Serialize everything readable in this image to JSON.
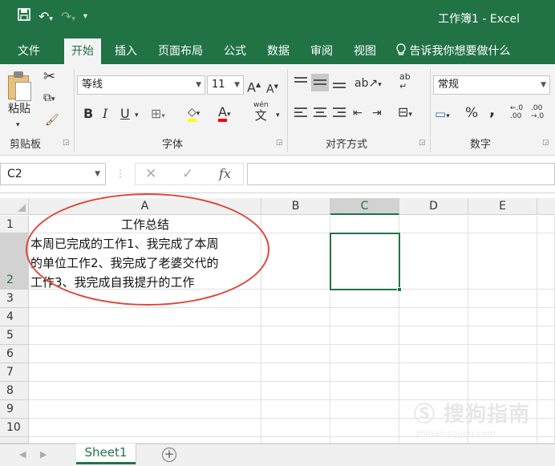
{
  "titlebar": {
    "title": "工作簿1 - Excel",
    "qat_icons": [
      "save-icon",
      "undo-icon",
      "redo-icon",
      "customize-icon"
    ]
  },
  "tabs": [
    {
      "label": "文件"
    },
    {
      "label": "开始",
      "active": true
    },
    {
      "label": "插入"
    },
    {
      "label": "页面布局"
    },
    {
      "label": "公式"
    },
    {
      "label": "数据"
    },
    {
      "label": "审阅"
    },
    {
      "label": "视图"
    }
  ],
  "tell_me": "告诉我你想要做什么",
  "ribbon": {
    "clipboard": {
      "paste_label": "粘贴",
      "group_label": "剪贴板"
    },
    "font": {
      "font_name": "等线",
      "font_size": "11",
      "increase_size": "A",
      "decrease_size": "A",
      "bold": "B",
      "italic": "I",
      "underline": "U",
      "font_color_glyph": "A",
      "pinyin_top": "wén",
      "pinyin_char": "文",
      "group_label": "字体"
    },
    "alignment": {
      "group_label": "对齐方式",
      "wrap_glyph": "ab"
    },
    "number": {
      "format": "常规",
      "percent": "%",
      "comma": ",",
      "increase_decimal": "←.0 .00",
      "decrease_decimal": ".00 →.0",
      "group_label": "数字"
    }
  },
  "formula_bar": {
    "name_box": "C2",
    "cancel_glyph": "✕",
    "enter_glyph": "✓",
    "fx": "fx",
    "value": ""
  },
  "grid": {
    "columns": [
      "A",
      "B",
      "C",
      "D",
      "E"
    ],
    "rows": [
      "1",
      "2",
      "3",
      "4",
      "5",
      "6",
      "7",
      "8",
      "9",
      "10"
    ],
    "cells": {
      "A1": "工作总结",
      "A2_lines": [
        "本周已完成的工作1、我完成了本周",
        "的单位工作2、我完成了老婆交代的",
        "工作3、我完成自我提升的工作"
      ]
    },
    "selected_cell": "C2"
  },
  "sheets": [
    {
      "name": "Sheet1",
      "active": true
    }
  ],
  "watermark": {
    "text": "搜狗指南",
    "subtext": "zhinan.sogou.com"
  },
  "colors": {
    "accent": "#217346",
    "annotation": "#e0453a"
  }
}
